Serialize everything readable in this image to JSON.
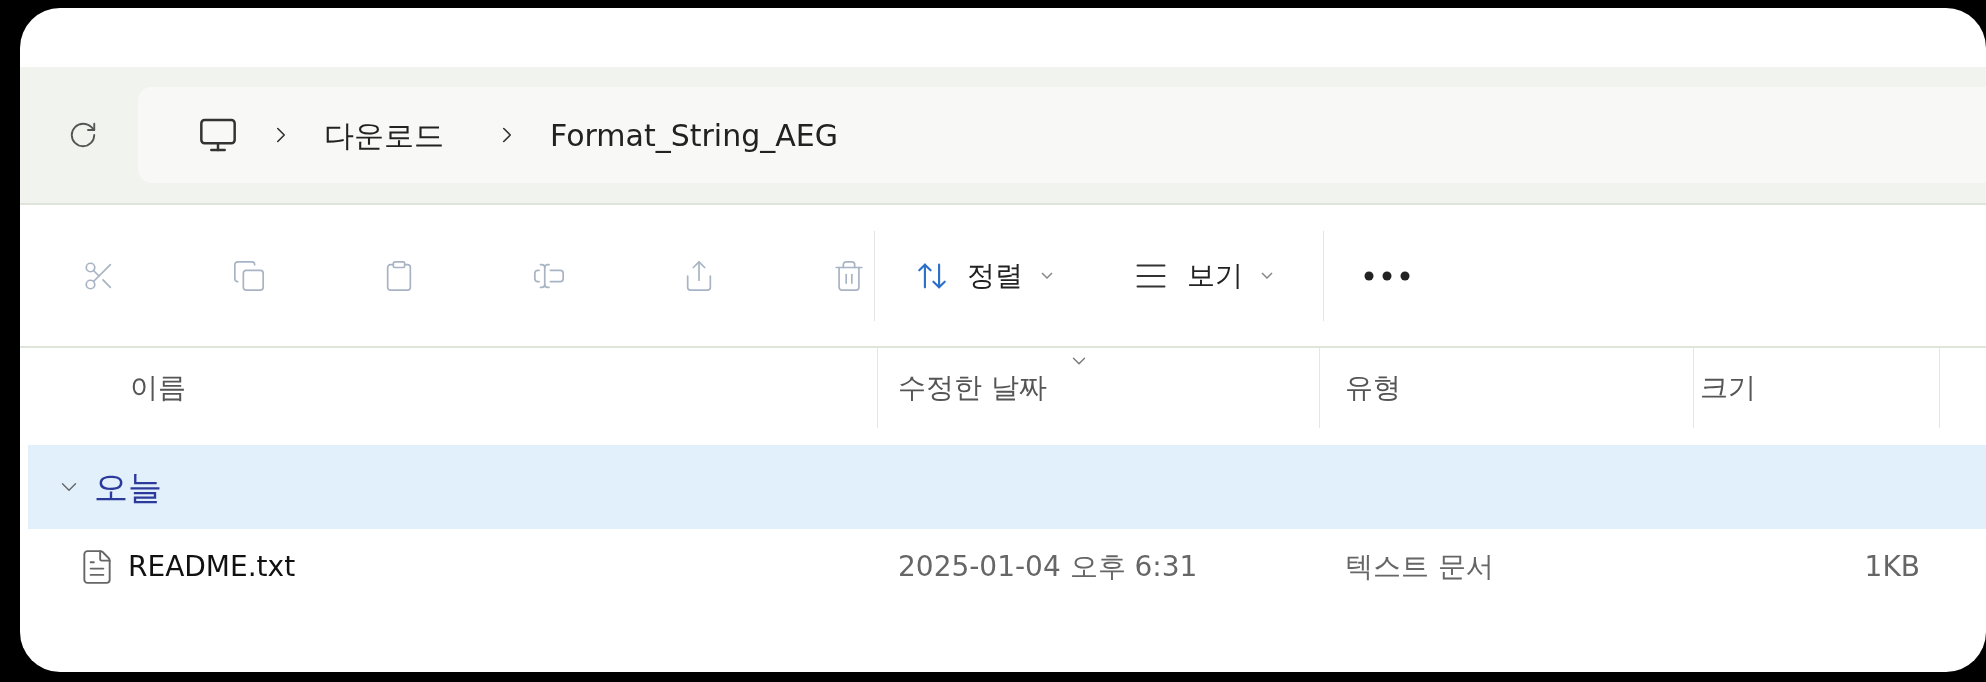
{
  "address_bar": {
    "crumbs": [
      "다운로드",
      "Format_String_AEG"
    ]
  },
  "toolbar": {
    "actions": [
      {
        "kind": "cut",
        "disabled": true
      },
      {
        "kind": "copy",
        "disabled": true
      },
      {
        "kind": "paste",
        "disabled": true
      },
      {
        "kind": "rename",
        "disabled": true
      },
      {
        "kind": "share",
        "disabled": true
      },
      {
        "kind": "delete",
        "disabled": true
      }
    ],
    "sort": "정렬",
    "view": "보기"
  },
  "columns": [
    {
      "label": "이름",
      "sorted": false
    },
    {
      "label": "수정한 날짜",
      "sorted": true
    },
    {
      "label": "유형",
      "sorted": false
    },
    {
      "label": "크기",
      "sorted": false
    }
  ],
  "groups": [
    {
      "label": "오늘",
      "expanded": true,
      "files": [
        {
          "name": "README.txt",
          "modified": "2025-01-04 오후 6:31",
          "type": "텍스트 문서",
          "size": "1KB"
        }
      ]
    }
  ]
}
